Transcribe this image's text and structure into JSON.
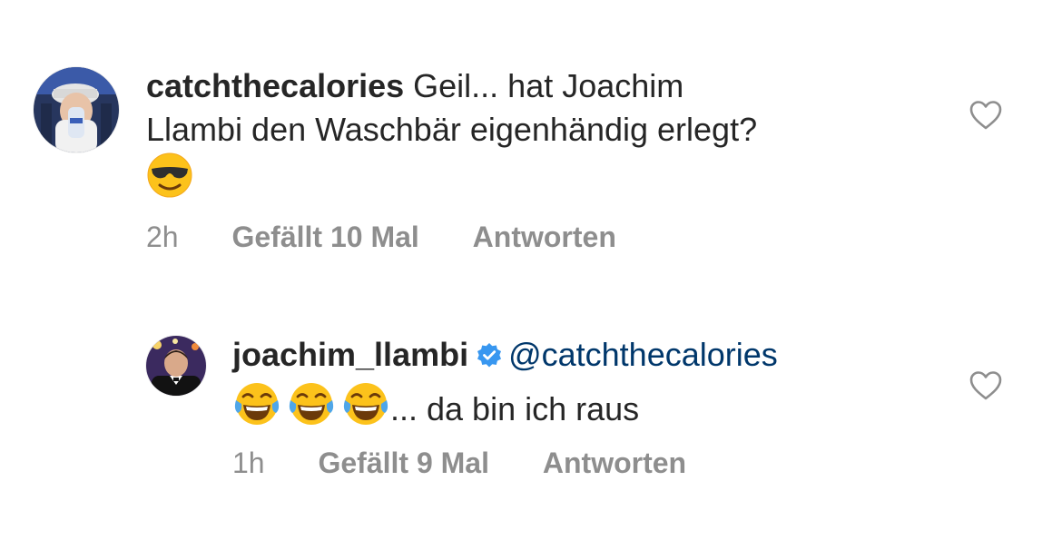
{
  "comments": [
    {
      "username": "catchthecalories",
      "text_line1": "Geil... hat Joachim",
      "text_line2": "Llambi den Waschbär eigenhändig erlegt?",
      "emoji": "smiling-face-with-sunglasses",
      "time": "2h",
      "likes": "Gefällt 10 Mal",
      "reply": "Antworten",
      "verified": false
    },
    {
      "username": "joachim_llambi",
      "mention": "@catchthecalories",
      "emoji": "face-with-tears-of-joy",
      "text": "... da bin ich raus",
      "time": "1h",
      "likes": "Gefällt 9 Mal",
      "reply": "Antworten",
      "verified": true
    }
  ],
  "colors": {
    "text": "#262626",
    "secondary": "#8e8e8e",
    "mention": "#00376b",
    "verified": "#3897f0"
  }
}
